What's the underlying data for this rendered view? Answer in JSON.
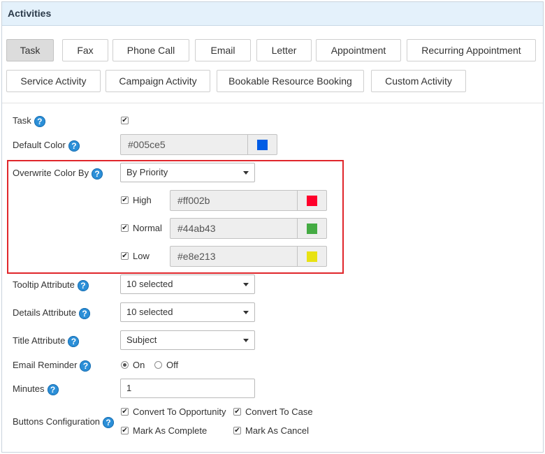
{
  "header": {
    "title": "Activities"
  },
  "tabs": [
    {
      "label": "Task"
    },
    {
      "label": "Fax"
    },
    {
      "label": "Phone Call"
    },
    {
      "label": "Email"
    },
    {
      "label": "Letter"
    },
    {
      "label": "Appointment"
    },
    {
      "label": "Recurring Appointment"
    },
    {
      "label": "Service Activity"
    },
    {
      "label": "Campaign Activity"
    },
    {
      "label": "Bookable Resource Booking"
    },
    {
      "label": "Custom Activity"
    }
  ],
  "form": {
    "task_label": "Task",
    "default_color_label": "Default Color",
    "default_color_value": "#005ce5",
    "default_color_swatch": "#005ce5",
    "overwrite_label": "Overwrite Color By",
    "overwrite_value": "By Priority",
    "priorities": [
      {
        "label": "High",
        "value": "#ff002b",
        "swatch": "#ff002b"
      },
      {
        "label": "Normal",
        "value": "#44ab43",
        "swatch": "#44ab43"
      },
      {
        "label": "Low",
        "value": "#e8e213",
        "swatch": "#e8e213"
      }
    ],
    "tooltip_label": "Tooltip Attribute",
    "tooltip_value": "10 selected",
    "details_label": "Details Attribute",
    "details_value": "10 selected",
    "title_label": "Title Attribute",
    "title_value": "Subject",
    "email_reminder_label": "Email Reminder",
    "on_label": "On",
    "off_label": "Off",
    "minutes_label": "Minutes",
    "minutes_value": "1",
    "buttons_label": "Buttons Configuration",
    "buttons": [
      {
        "label": "Convert To Opportunity"
      },
      {
        "label": "Convert To Case"
      },
      {
        "label": "Mark As Complete"
      },
      {
        "label": "Mark As Cancel"
      }
    ]
  },
  "icons": {
    "help": "question-mark",
    "check": "✔"
  },
  "colors": {
    "header_bg": "#e4f1fb",
    "help_icon": "#2b8fd8",
    "highlight_border": "#e0262b"
  }
}
